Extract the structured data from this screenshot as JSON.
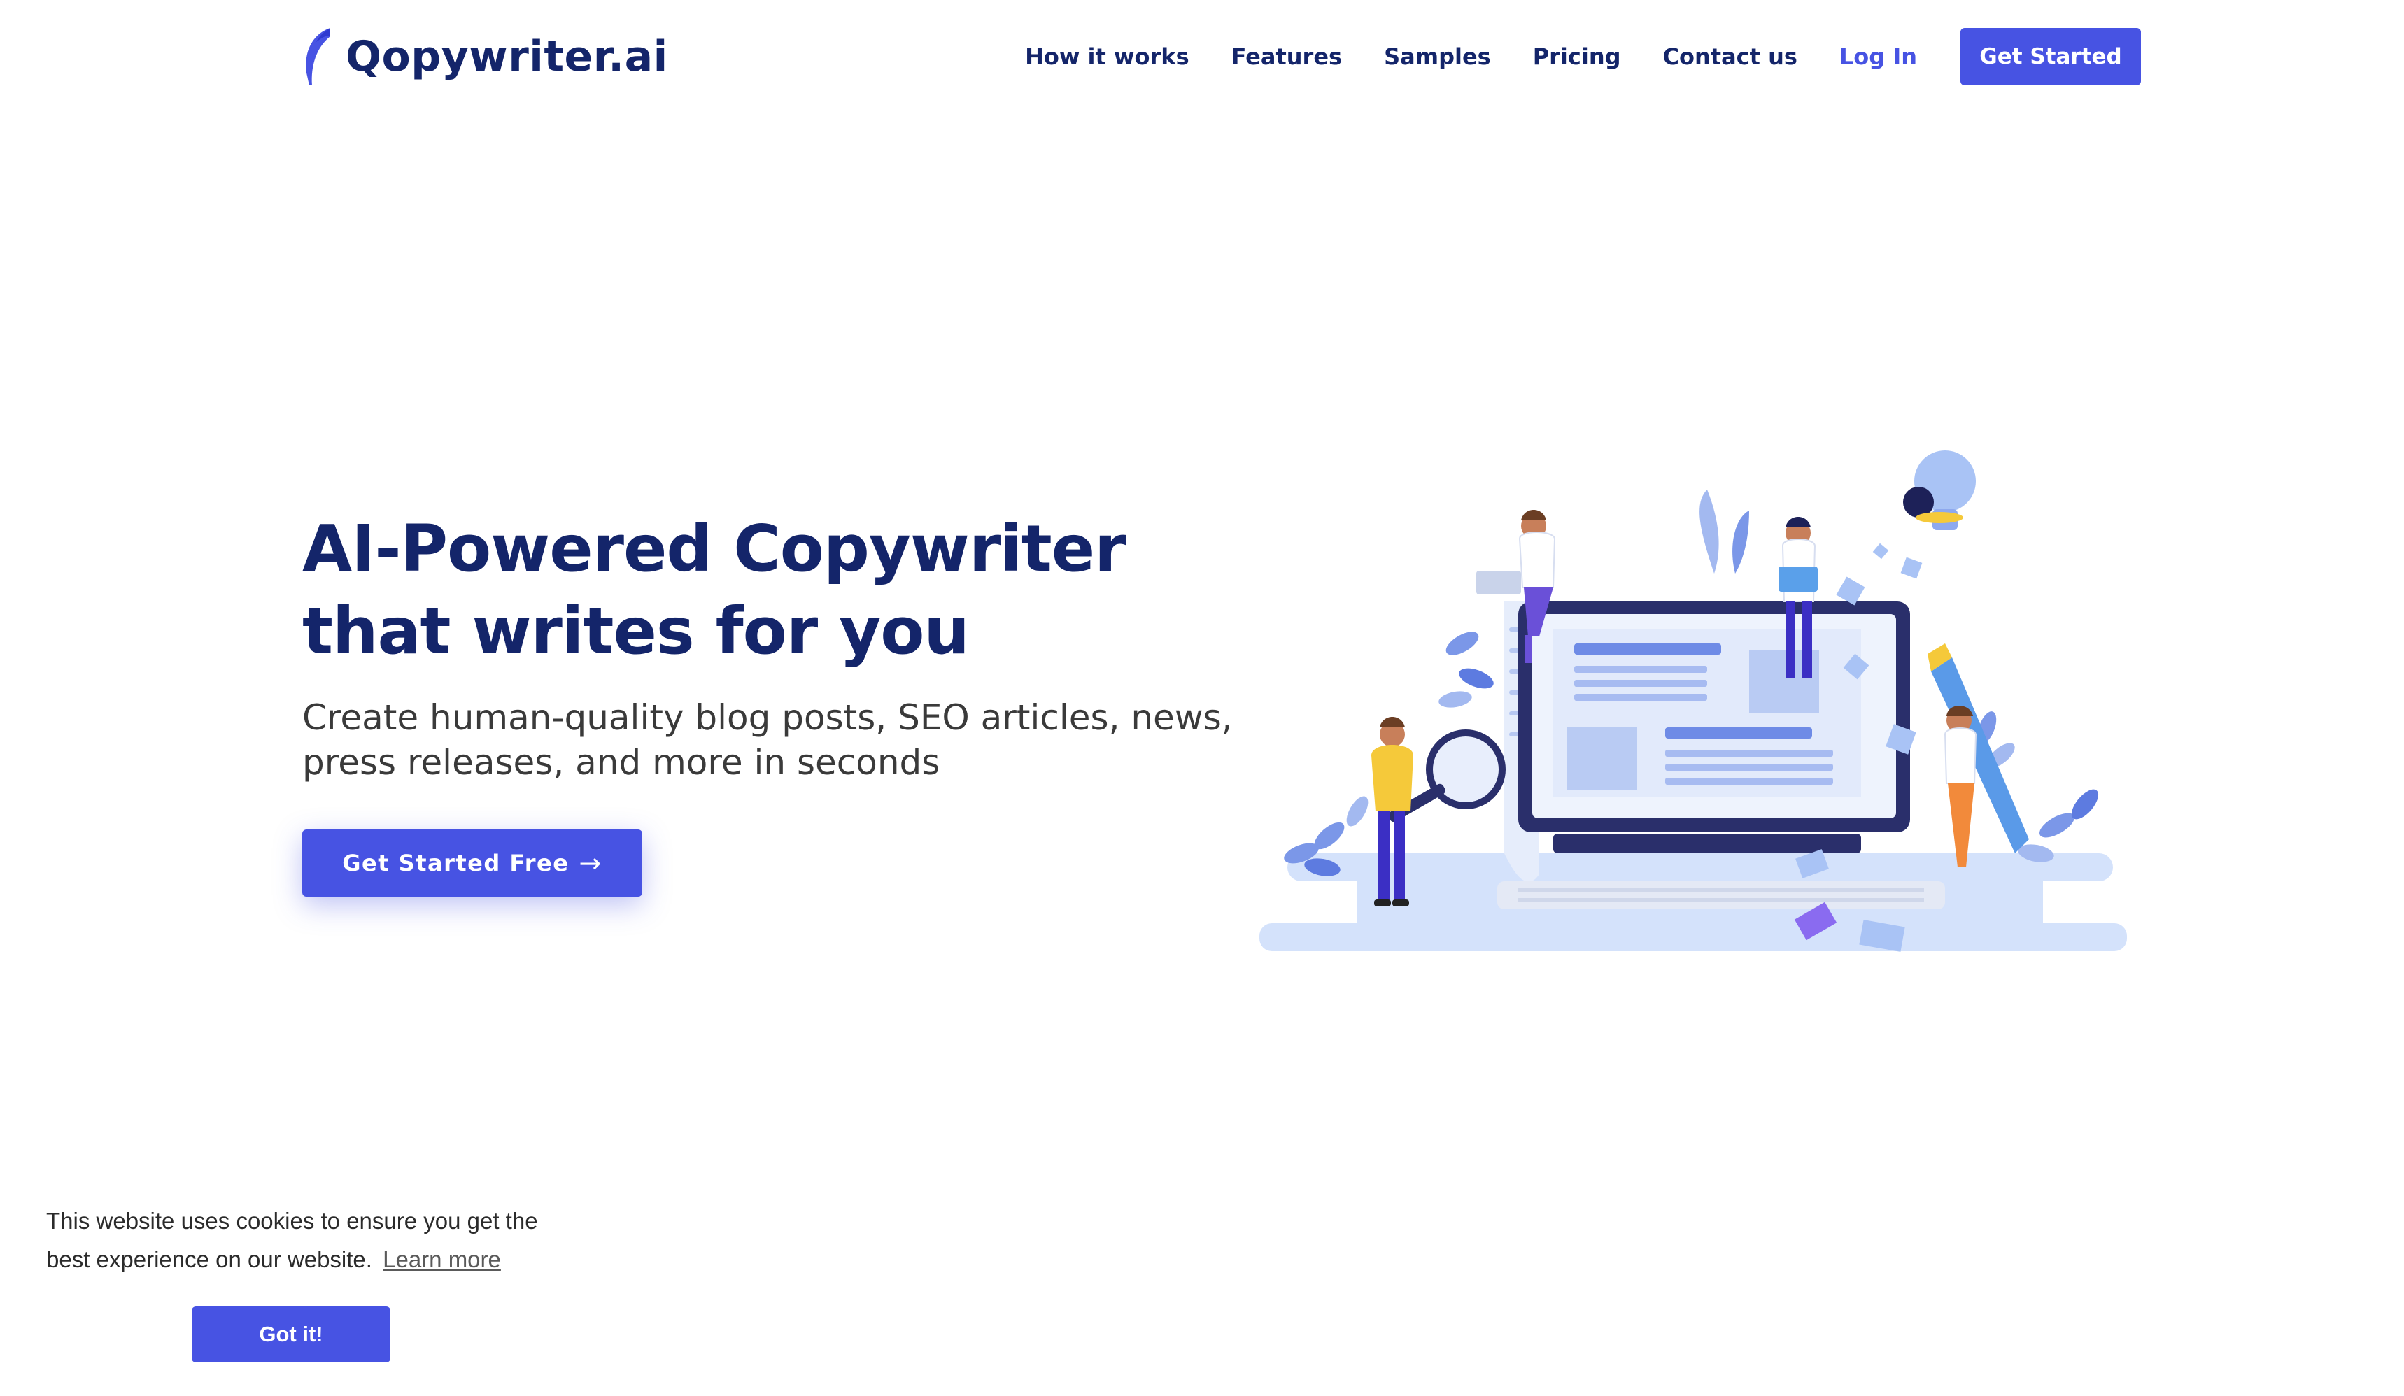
{
  "brand": {
    "name": "Qopywriter.ai",
    "logo_icon": "feather-icon",
    "color_primary": "#4753e3",
    "color_navy": "#14256a"
  },
  "nav": {
    "items": [
      {
        "label": "How it works"
      },
      {
        "label": "Features"
      },
      {
        "label": "Samples"
      },
      {
        "label": "Pricing"
      },
      {
        "label": "Contact us"
      }
    ],
    "login_label": "Log In",
    "cta_label": "Get Started"
  },
  "hero": {
    "title": "AI-Powered Copywriter that writes for you",
    "subtitle": "Create human-quality blog posts, SEO articles, news, press releases, and more in seconds",
    "cta_label": "Get Started Free",
    "cta_icon": "arrow-right-icon"
  },
  "cookie": {
    "message": "This website uses cookies to ensure you get the best experience on our website.",
    "learn_more": "Learn more",
    "accept_label": "Got it!"
  }
}
